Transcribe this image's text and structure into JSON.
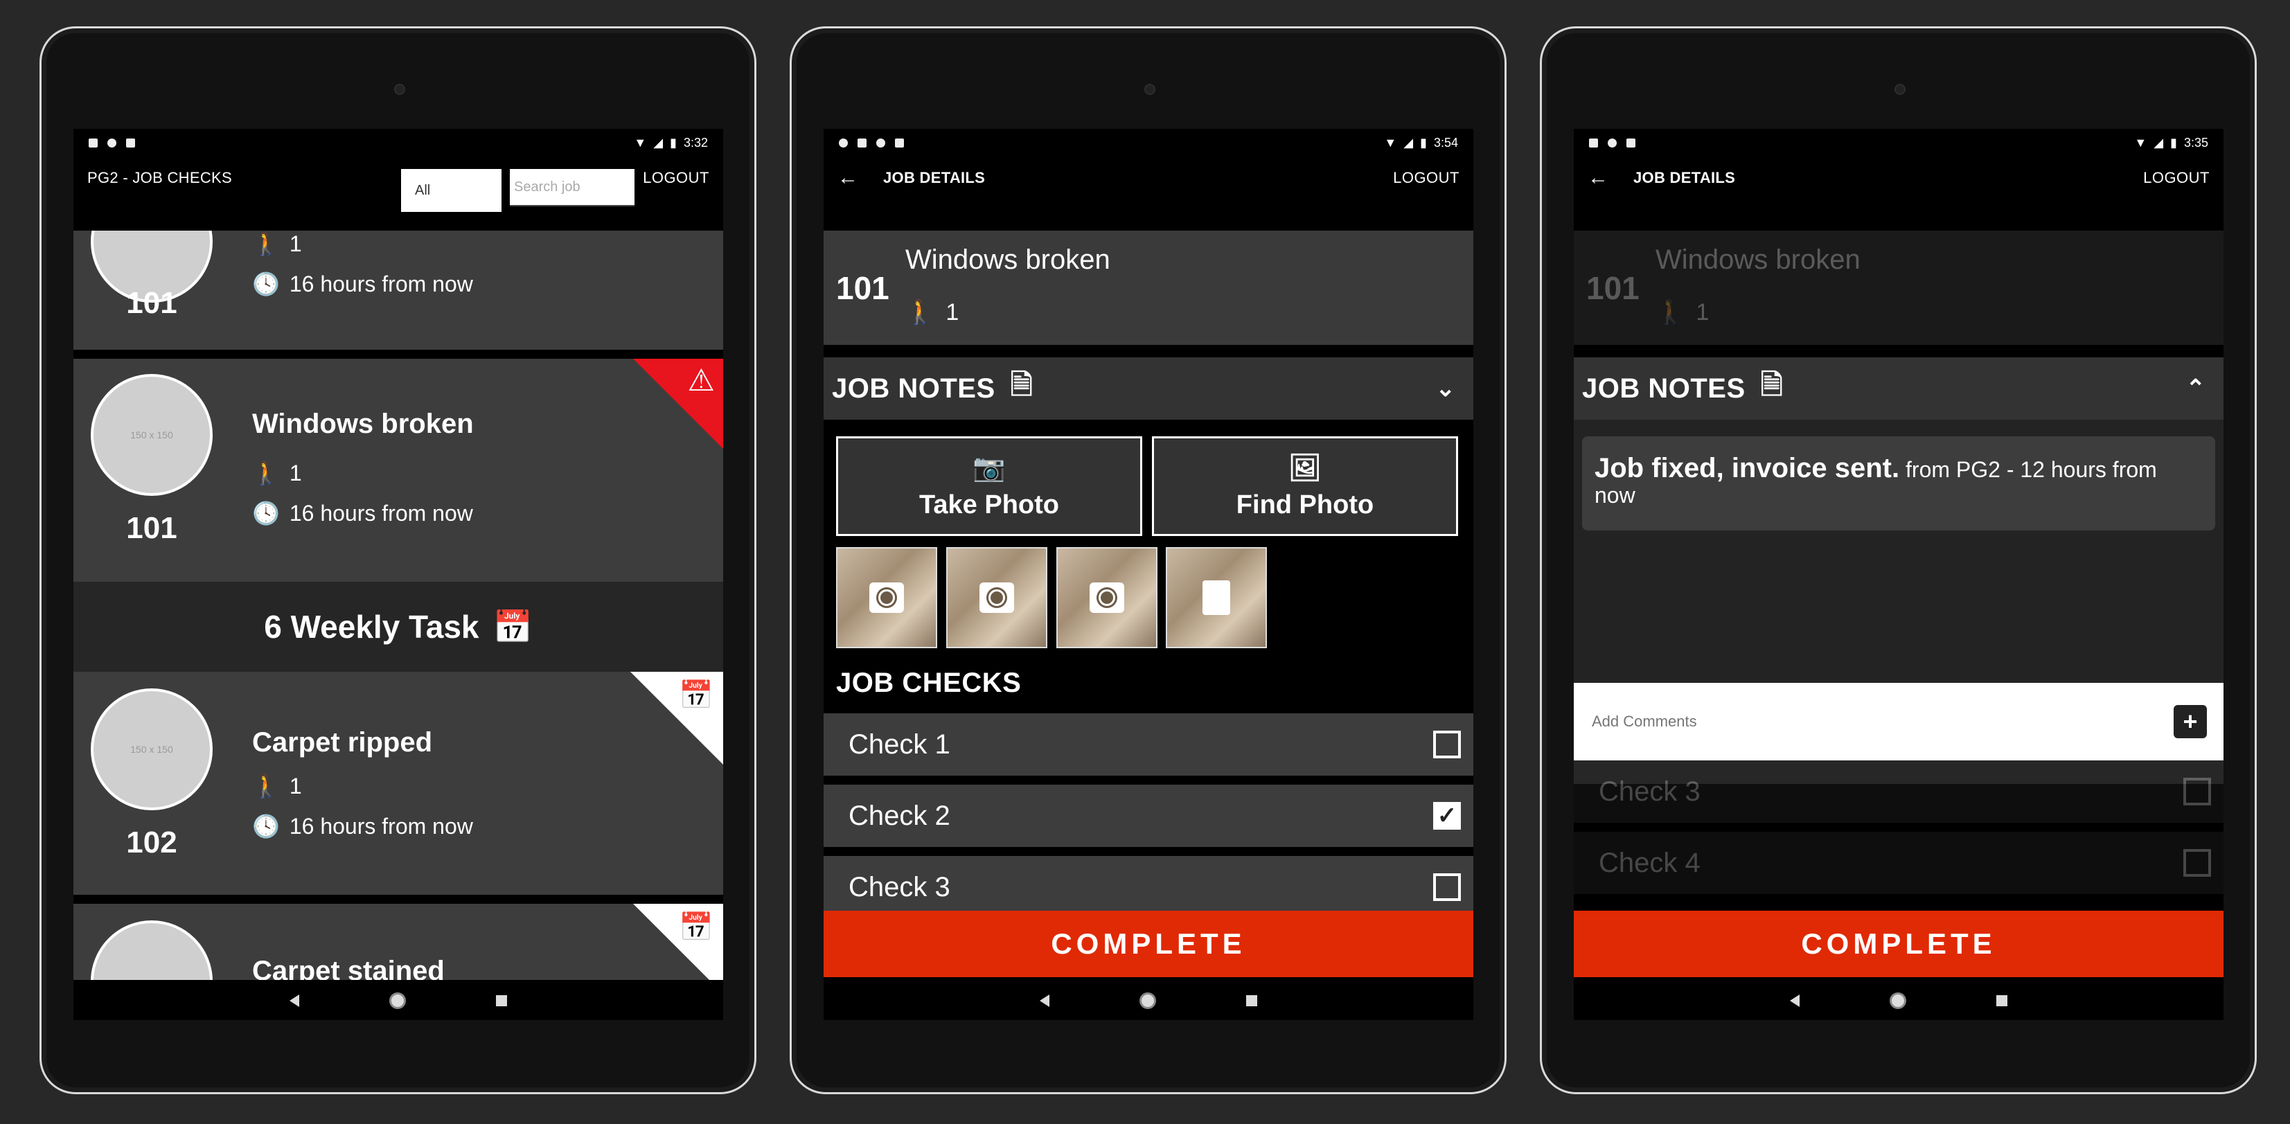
{
  "screens": [
    {
      "status": {
        "time": "3:32"
      },
      "appbar": {
        "title": "PG2 - JOB CHECKS",
        "filter_value": "All",
        "search_placeholder": "Search job",
        "logout": "LOGOUT"
      },
      "cards": [
        {
          "people": "1",
          "due": "16 hours from now",
          "number": "101"
        },
        {
          "title": "Windows broken",
          "people": "1",
          "due": "16 hours from now",
          "number": "101",
          "avatar_text": "150 x 150",
          "badge": "warning-icon"
        },
        {
          "title": "Carpet ripped",
          "people": "1",
          "due": "16 hours from now",
          "number": "102",
          "avatar_text": "150 x 150",
          "badge": "calendar-icon"
        },
        {
          "title": "Carpet stained",
          "badge": "calendar-icon"
        }
      ],
      "section": {
        "title": "6 Weekly Task"
      }
    },
    {
      "status": {
        "time": "3:54"
      },
      "appbar": {
        "title": "JOB DETAILS",
        "logout": "LOGOUT"
      },
      "job": {
        "number": "101",
        "title": "Windows broken",
        "people": "1"
      },
      "notes_title": "JOB NOTES",
      "take_photo": "Take Photo",
      "find_photo": "Find Photo",
      "checks_title": "JOB CHECKS",
      "checks": [
        {
          "label": "Check 1",
          "checked": false
        },
        {
          "label": "Check 2",
          "checked": true
        },
        {
          "label": "Check 3",
          "checked": false
        }
      ],
      "complete": "COMPLETE"
    },
    {
      "status": {
        "time": "3:35"
      },
      "appbar": {
        "title": "JOB DETAILS",
        "logout": "LOGOUT"
      },
      "job": {
        "number": "101",
        "title": "Windows broken",
        "people": "1"
      },
      "notes_title": "JOB NOTES",
      "note": {
        "text": "Job fixed, invoice sent.",
        "meta": "from PG2 - 12 hours from now"
      },
      "comment_placeholder": "Add Comments",
      "checks": [
        {
          "label": "Check 3",
          "checked": false
        },
        {
          "label": "Check 4",
          "checked": false
        }
      ],
      "complete": "COMPLETE"
    }
  ],
  "colors": {
    "accent": "#e02a05",
    "warning_badge": "#e8141e",
    "card": "#3d3d3d"
  }
}
